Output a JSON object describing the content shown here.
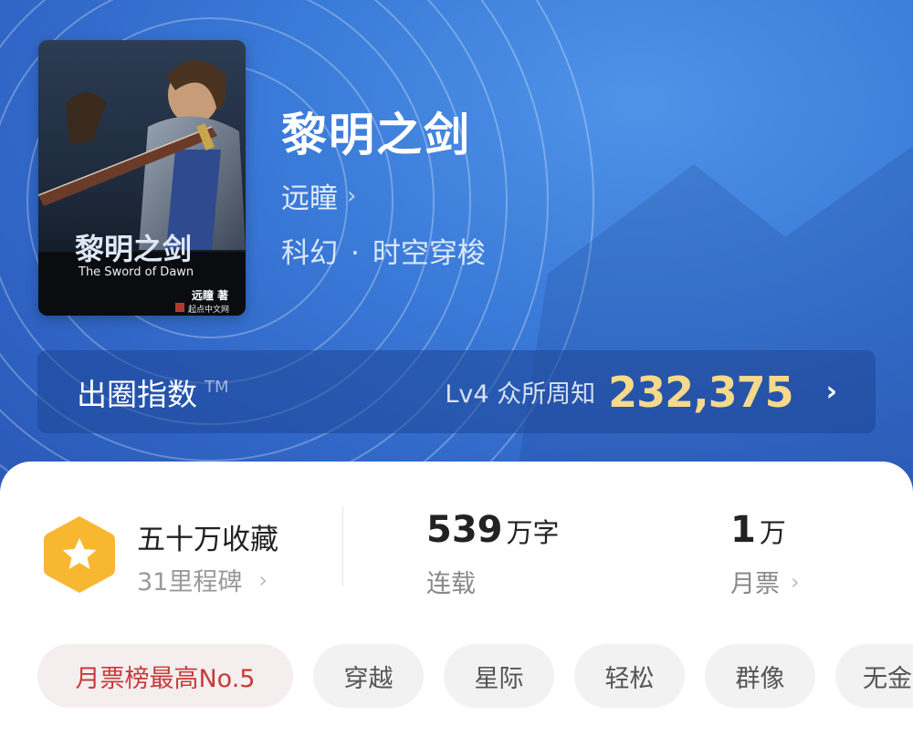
{
  "book": {
    "title": "黎明之剑",
    "author": "远瞳",
    "genre": "科幻",
    "genre_sep": "·",
    "subgenre": "时空穿梭",
    "cover": {
      "title_cn": "黎明之剑",
      "title_en": "The Sword of Dawn",
      "author_mark": "远瞳 著",
      "publisher": "起点中文网"
    }
  },
  "index_bar": {
    "label": "出圈指数",
    "tm": "TM",
    "level": "Lv4 众所周知",
    "score": "232,375"
  },
  "stats": {
    "collections": "五十万收藏",
    "milestone": "31里程碑",
    "word_count": "539",
    "word_unit": "万字",
    "status": "连载",
    "monthly_votes": "1",
    "votes_unit": "万",
    "votes_label": "月票"
  },
  "tags": [
    {
      "label": "月票榜最高No.5"
    },
    {
      "label": "穿越"
    },
    {
      "label": "星际"
    },
    {
      "label": "轻松"
    },
    {
      "label": "群像"
    },
    {
      "label": "无金"
    }
  ],
  "icons": {
    "author_chevron": "chevron-right-icon",
    "badge": "star-hexagon-badge-icon",
    "index_chevron": "chevron-right-icon"
  },
  "colors": {
    "header_bg": "#3a7ad8",
    "score": "#f7d98c",
    "badge": "#f7b731",
    "rank_tag_text": "#c93a3a"
  }
}
